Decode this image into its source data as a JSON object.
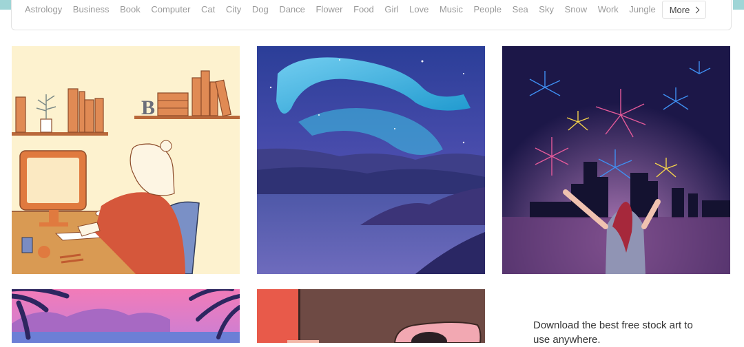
{
  "categories": [
    "Astrology",
    "Business",
    "Book",
    "Computer",
    "Cat",
    "City",
    "Dog",
    "Dance",
    "Flower",
    "Food",
    "Girl",
    "Love",
    "Music",
    "People",
    "Sea",
    "Sky",
    "Snow",
    "Work",
    "Jungle"
  ],
  "more_label": "More",
  "promo_text": "Download the best free stock art to use anywhere.",
  "tiles": [
    {
      "name": "illustration-person-at-computer",
      "icon": "desk-computer-illustration"
    },
    {
      "name": "illustration-aurora-lake",
      "icon": "aurora-illustration"
    },
    {
      "name": "illustration-fireworks-city",
      "icon": "fireworks-illustration"
    },
    {
      "name": "illustration-tropical-beach",
      "icon": "beach-illustration"
    },
    {
      "name": "illustration-pink-bedroom",
      "icon": "bedroom-illustration"
    }
  ]
}
